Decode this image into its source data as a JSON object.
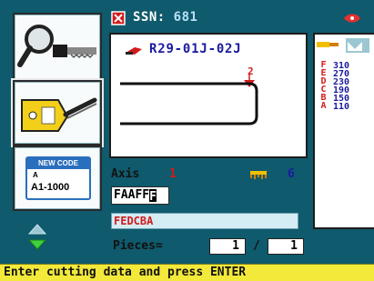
{
  "header": {
    "ssn_label": "SSN:",
    "ssn_value": "681"
  },
  "key": {
    "code": "R29-01J-02J",
    "marker": "2"
  },
  "tools": [
    {
      "name": "magnifier-key"
    },
    {
      "name": "test-key"
    },
    {
      "badge": "NEW CODE",
      "range": "A1-1000",
      "sub": "A"
    }
  ],
  "axis": {
    "label": "Axis",
    "value": "1",
    "count": "6"
  },
  "input": {
    "value": "FAAFF",
    "cursor": "F"
  },
  "sequence": {
    "value": "FEDCBA"
  },
  "pieces": {
    "label": "Pieces=",
    "current": "1",
    "slash": "/",
    "total": "1"
  },
  "right_panel": {
    "letters": "FEDCBA",
    "cuts": [
      "310",
      "270",
      "230",
      "190",
      "150",
      "110"
    ]
  },
  "status": {
    "text": "Enter cutting data and press ENTER"
  },
  "colors": {
    "background": "#0f5a6c",
    "accent_red": "#d21b1b",
    "accent_blue": "#1a1aa0",
    "status_bar": "#f2e93a"
  }
}
